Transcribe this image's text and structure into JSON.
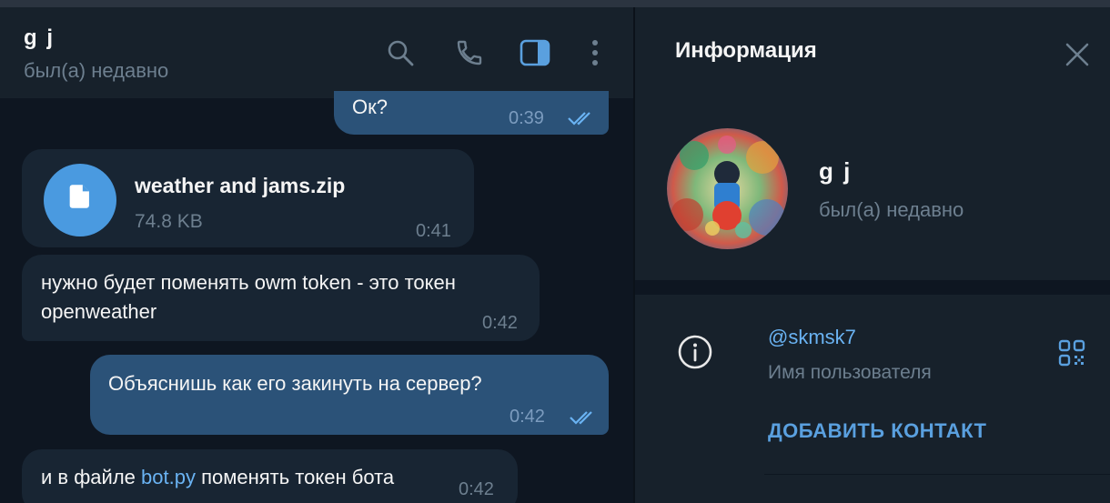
{
  "chat": {
    "name": "g j",
    "status": "был(а) недавно",
    "icons": [
      "search-icon",
      "phone-icon",
      "sidebar-toggle-icon",
      "more-vertical-icon"
    ],
    "accent_color": "#4a9ae0"
  },
  "messages": [
    {
      "direction": "out",
      "text": "Ок?",
      "time": "0:39",
      "read": true
    },
    {
      "direction": "in",
      "file_name": "weather and jams.zip",
      "file_size": "74.8 KB",
      "time": "0:41",
      "icon": "file-icon"
    },
    {
      "direction": "in",
      "text_line1": "нужно будет поменять owm token - это токен",
      "text_line2": "openweather",
      "time": "0:42"
    },
    {
      "direction": "out",
      "text": "Объяснишь как его закинуть на сервер?",
      "time": "0:42",
      "read": true
    },
    {
      "direction": "in",
      "text_before": "и в файле ",
      "link": "bot.py",
      "text_after": " поменять токен бота",
      "time": "0:42"
    }
  ],
  "info": {
    "title": "Информация",
    "profile_name": "g j",
    "profile_status": "был(а) недавно",
    "username": "@skmsk7",
    "username_label": "Имя пользователя",
    "add_contact": "ДОБАВИТЬ КОНТАКТ"
  }
}
